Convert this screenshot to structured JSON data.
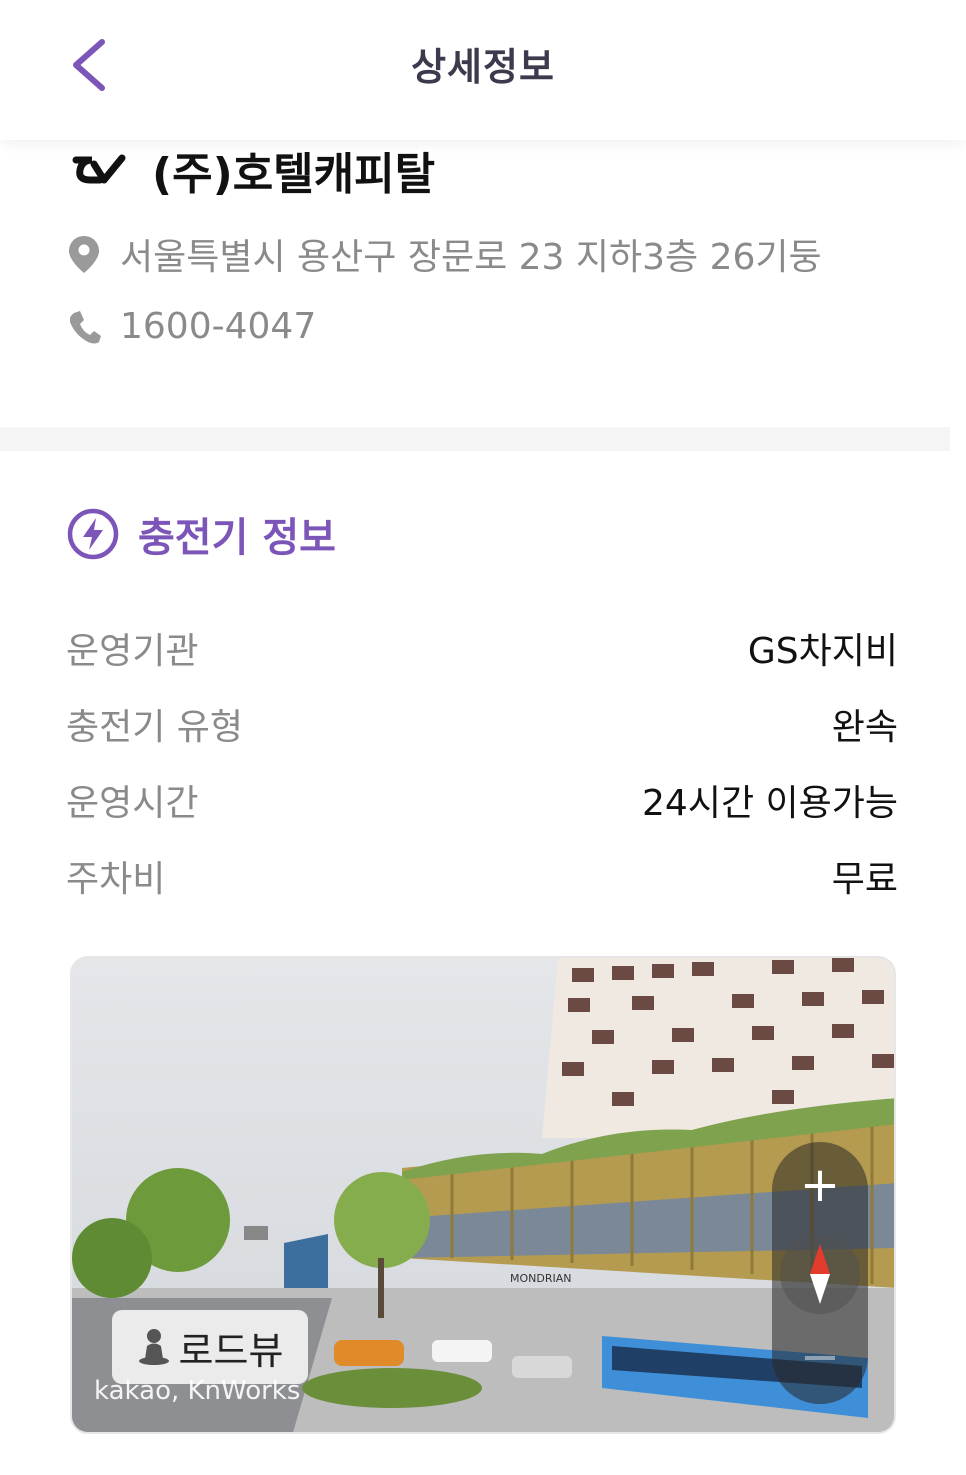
{
  "header": {
    "title": "상세정보",
    "back_icon": "chevron-left-icon",
    "accent": "#7c55b8"
  },
  "station": {
    "logo_icon": "gs-chargebee-logo",
    "name": "(주)호텔캐피탈",
    "address_icon": "map-pin-icon",
    "address": "서울특별시 용산구 장문로 23 지하3층 26기둥",
    "phone_icon": "phone-icon",
    "phone": "1600-4047"
  },
  "charger_info": {
    "icon": "lightning-circle-icon",
    "title": "충전기 정보",
    "rows": [
      {
        "label": "운영기관",
        "value": "GS차지비"
      },
      {
        "label": "충전기 유형",
        "value": "완속"
      },
      {
        "label": "운영시간",
        "value": "24시간 이용가능"
      },
      {
        "label": "주차비",
        "value": "무료"
      }
    ]
  },
  "roadview": {
    "badge_label": "로드뷰",
    "badge_icon": "person-icon",
    "watermark": "kakao, KnWorks",
    "sign_text": "MONDRIAN",
    "zoom_in": "+",
    "zoom_out": "−"
  }
}
